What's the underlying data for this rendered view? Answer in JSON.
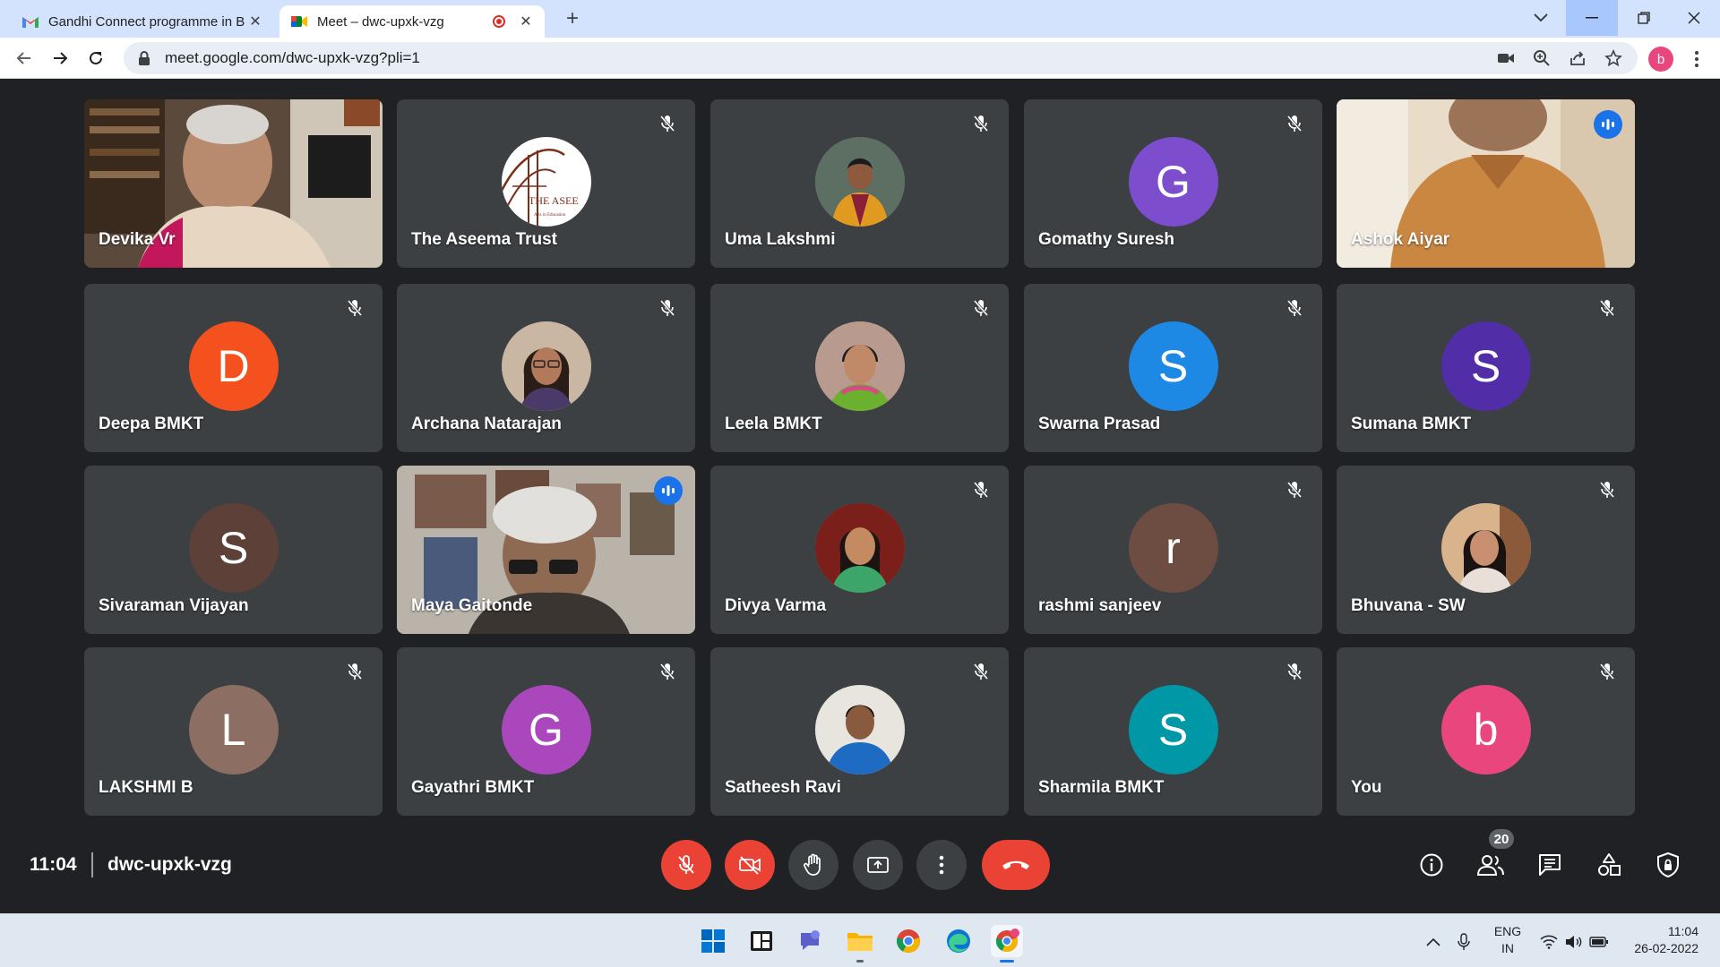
{
  "browser": {
    "tabs": [
      {
        "title": "Gandhi Connect programme in B",
        "active": false
      },
      {
        "title": "Meet – dwc-upxk-vzg",
        "active": true
      }
    ],
    "url": "meet.google.com/dwc-upxk-vzg?pli=1",
    "profile_initial": "b"
  },
  "participants": [
    {
      "name": "Devika Vr",
      "kind": "video",
      "muted": false,
      "speaking": false
    },
    {
      "name": "The Aseema Trust",
      "kind": "logo",
      "muted": true,
      "logo_text": "THE ASEE",
      "logo_sub": "Arts in Education"
    },
    {
      "name": "Uma Lakshmi",
      "kind": "photo",
      "muted": true
    },
    {
      "name": "Gomathy Suresh",
      "kind": "initial",
      "initial": "G",
      "color": "#7c4dcc",
      "muted": true
    },
    {
      "name": "Ashok Aiyar",
      "kind": "video",
      "muted": false,
      "speaking": true
    },
    {
      "name": "Deepa BMKT",
      "kind": "initial",
      "initial": "D",
      "color": "#f4511e",
      "muted": true
    },
    {
      "name": "Archana Natarajan",
      "kind": "photo",
      "muted": true
    },
    {
      "name": "Leela BMKT",
      "kind": "photo",
      "muted": true
    },
    {
      "name": "Swarna Prasad",
      "kind": "initial",
      "initial": "S",
      "color": "#1e88e5",
      "muted": true
    },
    {
      "name": "Sumana BMKT",
      "kind": "initial",
      "initial": "S",
      "color": "#512da8",
      "muted": true
    },
    {
      "name": "Sivaraman Vijayan",
      "kind": "initial",
      "initial": "S",
      "color": "#5d4037",
      "muted": false
    },
    {
      "name": "Maya Gaitonde",
      "kind": "video",
      "muted": false,
      "speaking": true
    },
    {
      "name": "Divya Varma",
      "kind": "photo",
      "muted": true
    },
    {
      "name": "rashmi sanjeev",
      "kind": "initial",
      "initial": "r",
      "color": "#6d4c41",
      "muted": true
    },
    {
      "name": "Bhuvana - SW",
      "kind": "photo",
      "muted": true
    },
    {
      "name": "LAKSHMI B",
      "kind": "initial",
      "initial": "L",
      "color": "#8d6e63",
      "muted": true
    },
    {
      "name": "Gayathri BMKT",
      "kind": "initial",
      "initial": "G",
      "color": "#ab47bc",
      "muted": true
    },
    {
      "name": "Satheesh Ravi",
      "kind": "photo",
      "muted": true
    },
    {
      "name": "Sharmila BMKT",
      "kind": "initial",
      "initial": "S",
      "color": "#0097a7",
      "muted": true
    },
    {
      "name": "You",
      "kind": "initial",
      "initial": "b",
      "color": "#e8467c",
      "muted": true
    }
  ],
  "meeting": {
    "time": "11:04",
    "code": "dwc-upxk-vzg",
    "participant_count": "20"
  },
  "colors": {
    "accent": "#1a73e8",
    "end_call": "#ea4335",
    "tile_bg": "#3c4043",
    "stage_bg": "#202124"
  },
  "system": {
    "lang_line1": "ENG",
    "lang_line2": "IN",
    "clock_time": "11:04",
    "clock_date": "26-02-2022"
  }
}
